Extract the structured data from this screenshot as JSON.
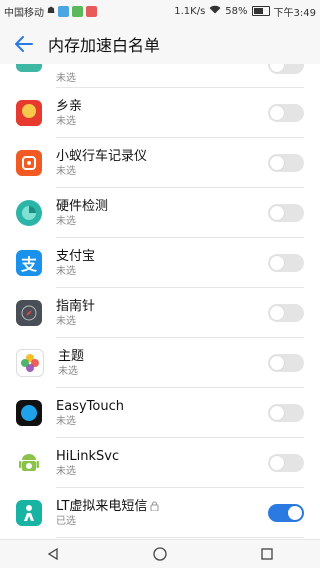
{
  "status_bar": {
    "carrier": "中国移动",
    "speed": "1.1K/s",
    "battery": "58%",
    "time": "下午3:49"
  },
  "app_bar": {
    "title": "内存加速白名单"
  },
  "list": [
    {
      "name": "",
      "status": "未选",
      "icon": "partial-app-icon",
      "enabled": false
    },
    {
      "name": "乡亲",
      "status": "未选",
      "icon": "xiangqin-app-icon",
      "enabled": false
    },
    {
      "name": "小蚁行车记录仪",
      "status": "未选",
      "icon": "dashcam-app-icon",
      "enabled": false
    },
    {
      "name": "硬件检测",
      "status": "未选",
      "icon": "hardware-test-icon",
      "enabled": false
    },
    {
      "name": "支付宝",
      "status": "未选",
      "icon": "alipay-icon",
      "enabled": false
    },
    {
      "name": "指南针",
      "status": "未选",
      "icon": "compass-icon",
      "enabled": false
    },
    {
      "name": "主题",
      "status": "未选",
      "icon": "themes-icon",
      "enabled": false
    },
    {
      "name": "EasyTouch",
      "status": "未选",
      "icon": "easytouch-icon",
      "enabled": false
    },
    {
      "name": "HiLinkSvc",
      "status": "未选",
      "icon": "android-icon",
      "enabled": false
    },
    {
      "name": "LT虚拟来电短信",
      "status": "已选",
      "icon": "lt-call-icon",
      "enabled": true,
      "locked": true
    }
  ],
  "colors": {
    "accent": "#2a7ae2"
  }
}
